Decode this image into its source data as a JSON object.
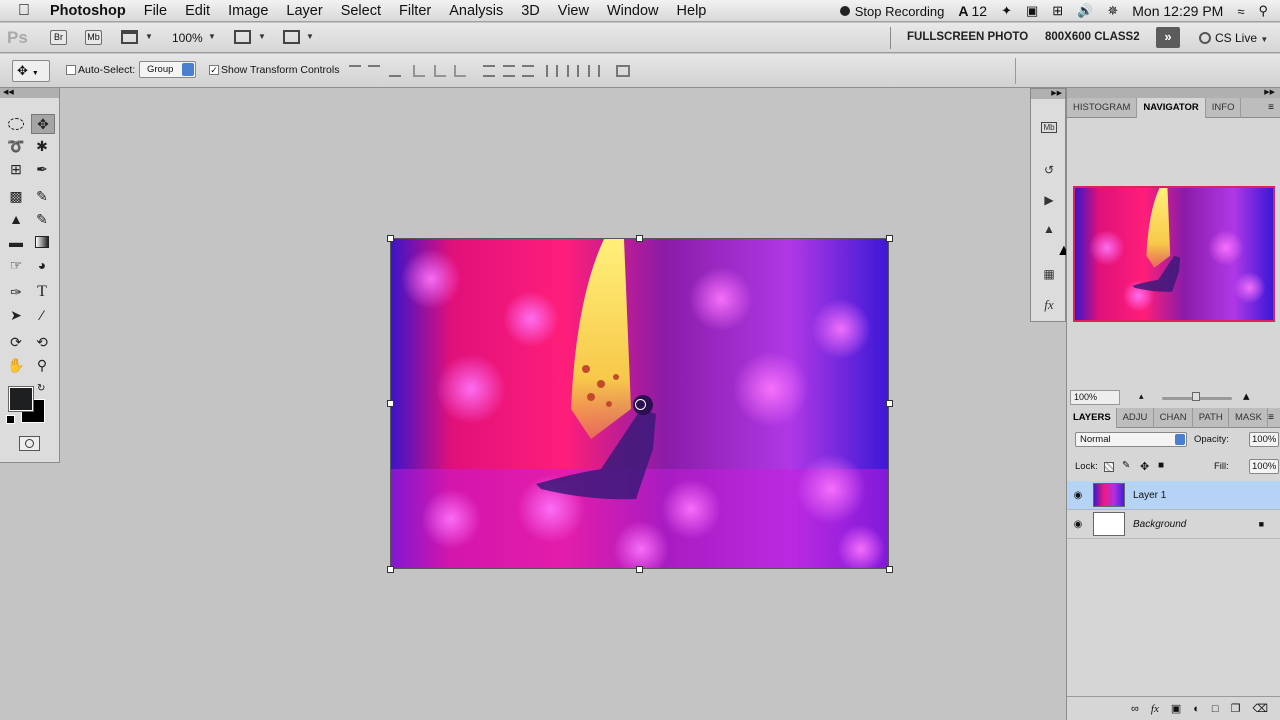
{
  "menubar": {
    "app_name": "Photoshop",
    "items": [
      "File",
      "Edit",
      "Image",
      "Layer",
      "Select",
      "Filter",
      "Analysis",
      "3D",
      "View",
      "Window",
      "Help"
    ],
    "stop_recording": "Stop Recording",
    "font_badge": "12",
    "clock": "Mon 12:29 PM"
  },
  "appbar": {
    "logo": "Ps",
    "br_label": "Br",
    "mb_label": "Mb",
    "zoom": "100%",
    "workspace_1": "FULLSCREEN PHOTO",
    "workspace_2": "800X600 CLASS2",
    "cs_live": "CS Live"
  },
  "options": {
    "auto_select_label": "Auto-Select:",
    "auto_select_value": "Group",
    "transform_label": "Show Transform Controls"
  },
  "navigator": {
    "tabs": [
      "HISTOGRAM",
      "NAVIGATOR",
      "INFO"
    ],
    "zoom": "100%"
  },
  "layers_panel": {
    "tabs": [
      "LAYERS",
      "ADJU",
      "CHAN",
      "PATH",
      "MASK"
    ],
    "blend_mode": "Normal",
    "opacity_label": "Opacity:",
    "opacity_value": "100%",
    "lock_label": "Lock:",
    "fill_label": "Fill:",
    "fill_value": "100%",
    "layers": [
      {
        "name": "Layer 1"
      },
      {
        "name": "Background"
      }
    ]
  },
  "colors": {
    "accent_selection": "#b5d3f5",
    "canvas_bg": "#c4c4c4"
  }
}
